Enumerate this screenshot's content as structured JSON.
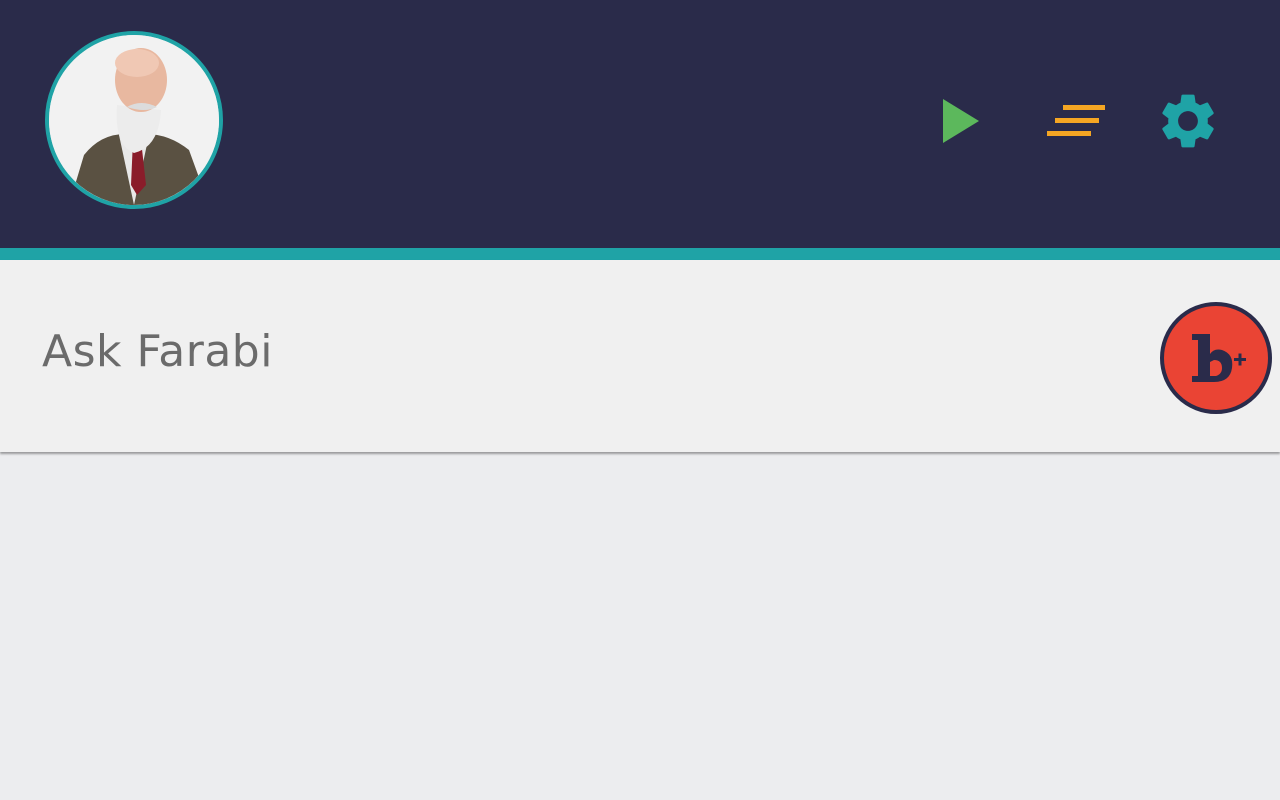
{
  "header": {
    "background_color": "#2a2b4a",
    "accent_color": "#1fa3a6",
    "avatar": {
      "icon": "avatar-portrait"
    },
    "actions": [
      {
        "id": "play",
        "icon": "play-icon",
        "color": "#5cb85c"
      },
      {
        "id": "list",
        "icon": "list-icon",
        "color": "#f5a623"
      },
      {
        "id": "settings",
        "icon": "gear-icon",
        "color": "#1fa3a6"
      }
    ]
  },
  "ask": {
    "label": "Ask Farabi",
    "badge": {
      "icon": "brand-logo-icon",
      "color": "#ea4434"
    }
  },
  "main": {
    "background_color": "#ecedef"
  }
}
